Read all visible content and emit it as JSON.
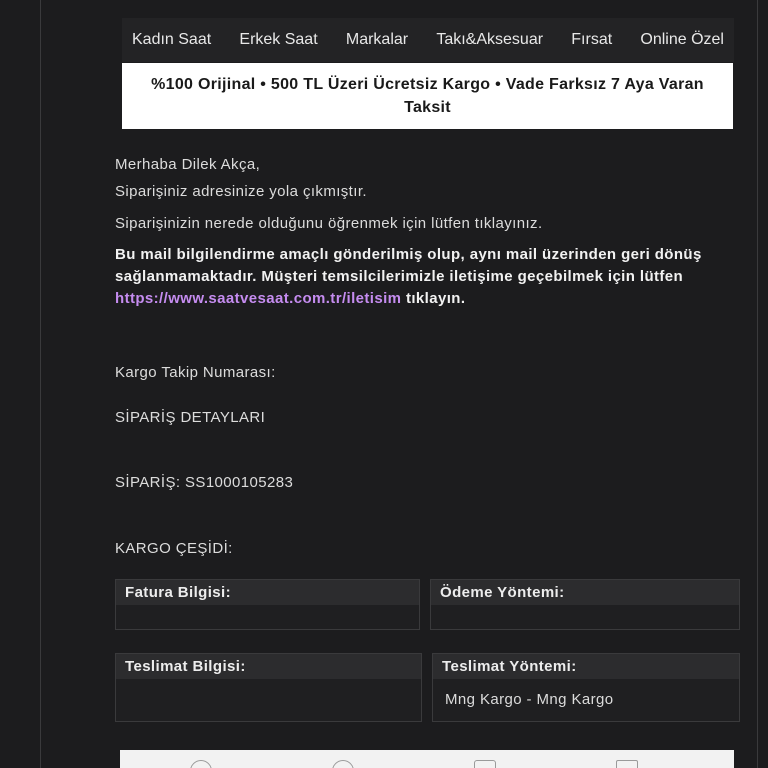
{
  "nav": {
    "items": [
      "Kadın Saat",
      "Erkek Saat",
      "Markalar",
      "Takı&Aksesuar",
      "Fırsat",
      "Online Özel"
    ]
  },
  "banner": {
    "text": "%100 Orijinal • 500 TL Üzeri Ücretsiz Kargo • Vade Farksız 7 Aya Varan Taksit"
  },
  "email": {
    "greeting": "Merhaba Dilek Akça,",
    "shipped": "Siparişiniz adresinize yola çıkmıştır.",
    "where": "Siparişinizin nerede olduğunu öğrenmek için lütfen tıklayınız.",
    "notice_before": "Bu mail bilgilendirme amaçlı gönderilmiş olup, aynı mail üzerinden geri dönüş sağlanmamaktadır. Müşteri temsilcilerimizle iletişime geçebilmek için lütfen ",
    "notice_link": "https://www.saatvesaat.com.tr/iletisim",
    "notice_after": " tıklayın.",
    "tracking_label": "Kargo Takip Numarası:",
    "details_heading": "SİPARİŞ DETAYLARI",
    "order_label": "SİPARİŞ: SS1000105283",
    "cargo_type_label": "KARGO ÇEŞİDİ:"
  },
  "boxes": {
    "fatura": {
      "header": "Fatura Bilgisi:",
      "value": ""
    },
    "odeme": {
      "header": "Ödeme Yöntemi:",
      "value": ""
    },
    "teslimat": {
      "header": "Teslimat Bilgisi:",
      "value": ""
    },
    "teslimat_yontemi": {
      "header": "Teslimat Yöntemi:",
      "value": "Mng Kargo - Mng Kargo"
    }
  }
}
